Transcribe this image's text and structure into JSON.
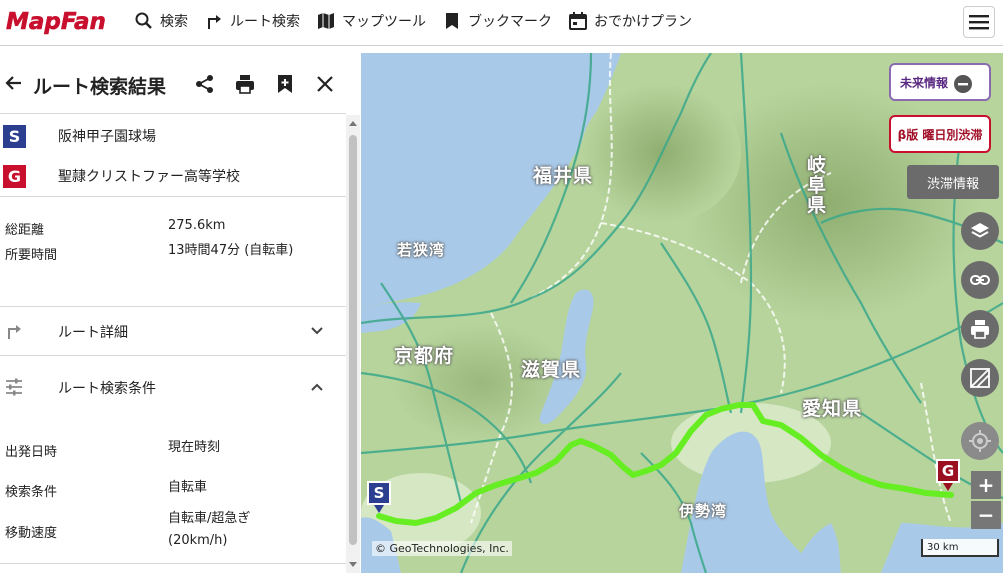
{
  "header": {
    "logo_text": "MapFan",
    "nav": [
      {
        "label": "検索",
        "icon": "search-icon"
      },
      {
        "label": "ルート検索",
        "icon": "route-turn-icon"
      },
      {
        "label": "マップツール",
        "icon": "map-icon"
      },
      {
        "label": "ブックマーク",
        "icon": "bookmark-icon"
      },
      {
        "label": "おでかけプラン",
        "icon": "calendar-icon"
      }
    ],
    "menu_icon": "hamburger-icon"
  },
  "panel": {
    "title": "ルート検索結果",
    "start": {
      "badge": "S",
      "name": "阪神甲子園球場",
      "color": "#2c3e8f"
    },
    "goal": {
      "badge": "G",
      "name": "聖隷クリストファー高等学校",
      "color": "#c8102e"
    },
    "summary": {
      "distance_label": "総距離",
      "distance_value": "275.6km",
      "time_label": "所要時間",
      "time_value": "13時間47分 (自転車)"
    },
    "sections": {
      "detail_label": "ルート詳細",
      "conditions_label": "ルート検索条件"
    },
    "conditions": {
      "departure_label": "出発日時",
      "departure_value": "現在時刻",
      "search_label": "検索条件",
      "search_value": "自転車",
      "speed_label": "移動速度",
      "speed_value_line1": "自転車/超急ぎ",
      "speed_value_line2": "(20km/h)"
    }
  },
  "map": {
    "labels": {
      "fukui": "福井県",
      "gifu": "岐阜県",
      "wakasa": "若狭湾",
      "kyoto": "京都府",
      "shiga": "滋賀県",
      "aichi": "愛知県",
      "ise": "伊勢湾"
    },
    "controls": {
      "future_info": "未来情報",
      "weekday_traffic": "β版 曜日別渋滞",
      "traffic_info": "渋滞情報",
      "zoom_in": "+",
      "zoom_out": "−"
    },
    "attribution": "© GeoTechnologies, Inc.",
    "scale": "30 km",
    "pin_start": "S",
    "pin_goal": "G",
    "colors": {
      "route": "#66ee22",
      "water": "#a9c9e8",
      "land": "#b7d49d"
    }
  }
}
